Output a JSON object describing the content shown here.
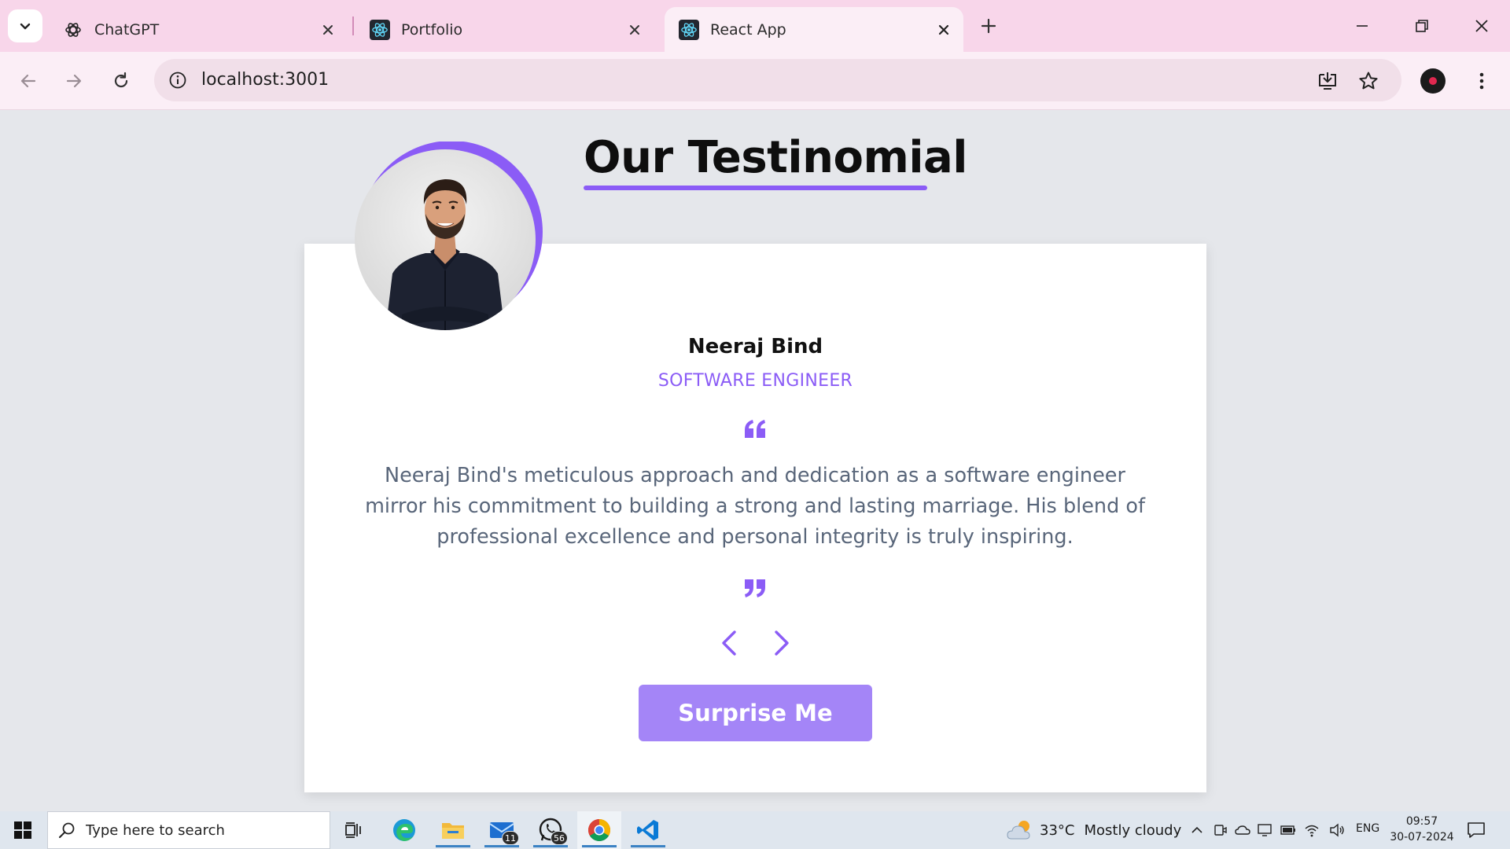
{
  "browser": {
    "tabs": [
      {
        "title": "ChatGPT",
        "icon": "chatgpt-icon"
      },
      {
        "title": "Portfolio",
        "icon": "react-icon"
      },
      {
        "title": "React App",
        "icon": "react-icon",
        "active": true
      }
    ],
    "address": "localhost:3001"
  },
  "page": {
    "heading": "Our Testinomial",
    "accent_color": "#8b5cf6",
    "testimonial": {
      "name": "Neeraj Bind",
      "role": "SOFTWARE ENGINEER",
      "text": "Neeraj Bind's meticulous approach and dedication as a software engineer mirror his commitment to building a strong and lasting marriage. His blend of professional excellence and personal integrity is truly inspiring."
    },
    "surprise_label": "Surprise Me"
  },
  "taskbar": {
    "search_placeholder": "Type here to search",
    "mail_badge": "11",
    "whatsapp_badge": "56",
    "weather": {
      "temp": "33°C",
      "condition": "Mostly cloudy"
    },
    "language": "ENG",
    "time": "09:57",
    "date": "30-07-2024"
  }
}
